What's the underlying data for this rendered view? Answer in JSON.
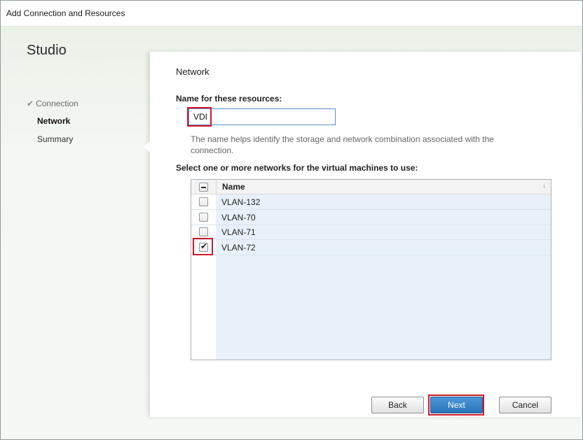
{
  "window": {
    "title": "Add Connection and Resources"
  },
  "sidebar": {
    "app_title": "Studio",
    "items": [
      {
        "label": "Connection",
        "state": "completed",
        "icon": "checkmark-icon"
      },
      {
        "label": "Network",
        "state": "active"
      },
      {
        "label": "Summary",
        "state": "pending"
      }
    ]
  },
  "main": {
    "section_title": "Network",
    "name_label": "Name for these resources:",
    "name_value": "VDI",
    "help_text": "The name helps identify the storage and network combination associated with the connection.",
    "networks_label": "Select one or more networks for the virtual machines to use:",
    "grid": {
      "header": {
        "name": "Name",
        "select_all_state": "indeterminate",
        "sort_icon": "sort-arrow-icon"
      },
      "rows": [
        {
          "name": "VLAN-132",
          "checked": false
        },
        {
          "name": "VLAN-70",
          "checked": false
        },
        {
          "name": "VLAN-71",
          "checked": false
        },
        {
          "name": "VLAN-72",
          "checked": true
        }
      ]
    }
  },
  "buttons": {
    "back": "Back",
    "next": "Next",
    "cancel": "Cancel"
  },
  "colors": {
    "highlight": "#d01a2a",
    "primary_button": "#2b74b9",
    "grid_selection": "#e8f1fa"
  }
}
